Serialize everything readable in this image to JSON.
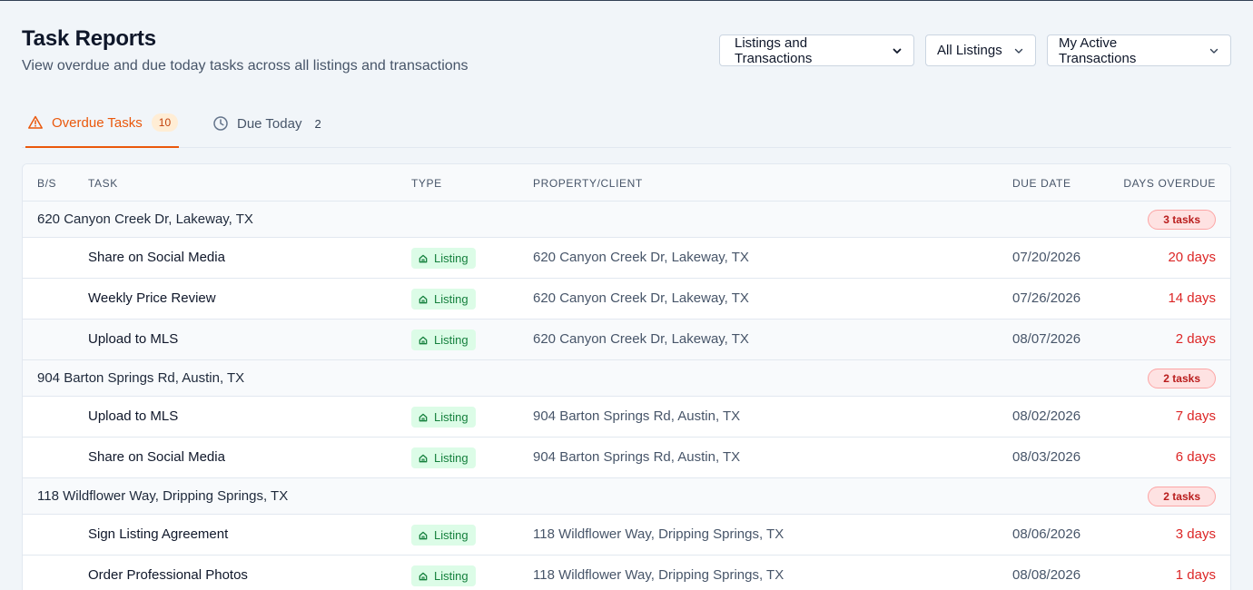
{
  "header": {
    "title": "Task Reports",
    "subtitle": "View overdue and due today tasks across all listings and transactions"
  },
  "filters": {
    "scope": "Listings and Transactions",
    "listings": "All Listings",
    "transactions": "My Active Transactions"
  },
  "tabs": [
    {
      "label": "Overdue Tasks",
      "count": "10",
      "icon": "warning-triangle-icon",
      "active": true
    },
    {
      "label": "Due Today",
      "count": "2",
      "icon": "clock-icon",
      "active": false
    }
  ],
  "table": {
    "headers": {
      "bs": "B/S",
      "task": "TASK",
      "type": "TYPE",
      "property": "PROPERTY/CLIENT",
      "due": "DUE DATE",
      "days": "DAYS OVERDUE"
    },
    "groups": [
      {
        "name": "620 Canyon Creek Dr, Lakeway, TX",
        "badge": "3 tasks",
        "rows": [
          {
            "task": "Share on Social Media",
            "type": "Listing",
            "property": "620 Canyon Creek Dr, Lakeway, TX",
            "due": "07/20/2026",
            "days": "20 days"
          },
          {
            "task": "Weekly Price Review",
            "type": "Listing",
            "property": "620 Canyon Creek Dr, Lakeway, TX",
            "due": "07/26/2026",
            "days": "14 days"
          },
          {
            "task": "Upload to MLS",
            "type": "Listing",
            "property": "620 Canyon Creek Dr, Lakeway, TX",
            "due": "08/07/2026",
            "days": "2 days"
          }
        ]
      },
      {
        "name": "904 Barton Springs Rd, Austin, TX",
        "badge": "2 tasks",
        "rows": [
          {
            "task": "Upload to MLS",
            "type": "Listing",
            "property": "904 Barton Springs Rd, Austin, TX",
            "due": "08/02/2026",
            "days": "7 days"
          },
          {
            "task": "Share on Social Media",
            "type": "Listing",
            "property": "904 Barton Springs Rd, Austin, TX",
            "due": "08/03/2026",
            "days": "6 days"
          }
        ]
      },
      {
        "name": "118 Wildflower Way, Dripping Springs, TX",
        "badge": "2 tasks",
        "rows": [
          {
            "task": "Sign Listing Agreement",
            "type": "Listing",
            "property": "118 Wildflower Way, Dripping Springs, TX",
            "due": "08/06/2026",
            "days": "3 days"
          },
          {
            "task": "Order Professional Photos",
            "type": "Listing",
            "property": "118 Wildflower Way, Dripping Springs, TX",
            "due": "08/08/2026",
            "days": "1 days"
          }
        ]
      }
    ]
  },
  "colors": {
    "accent": "#ea580c",
    "overdue": "#dc2626",
    "listing": "#15803d"
  }
}
